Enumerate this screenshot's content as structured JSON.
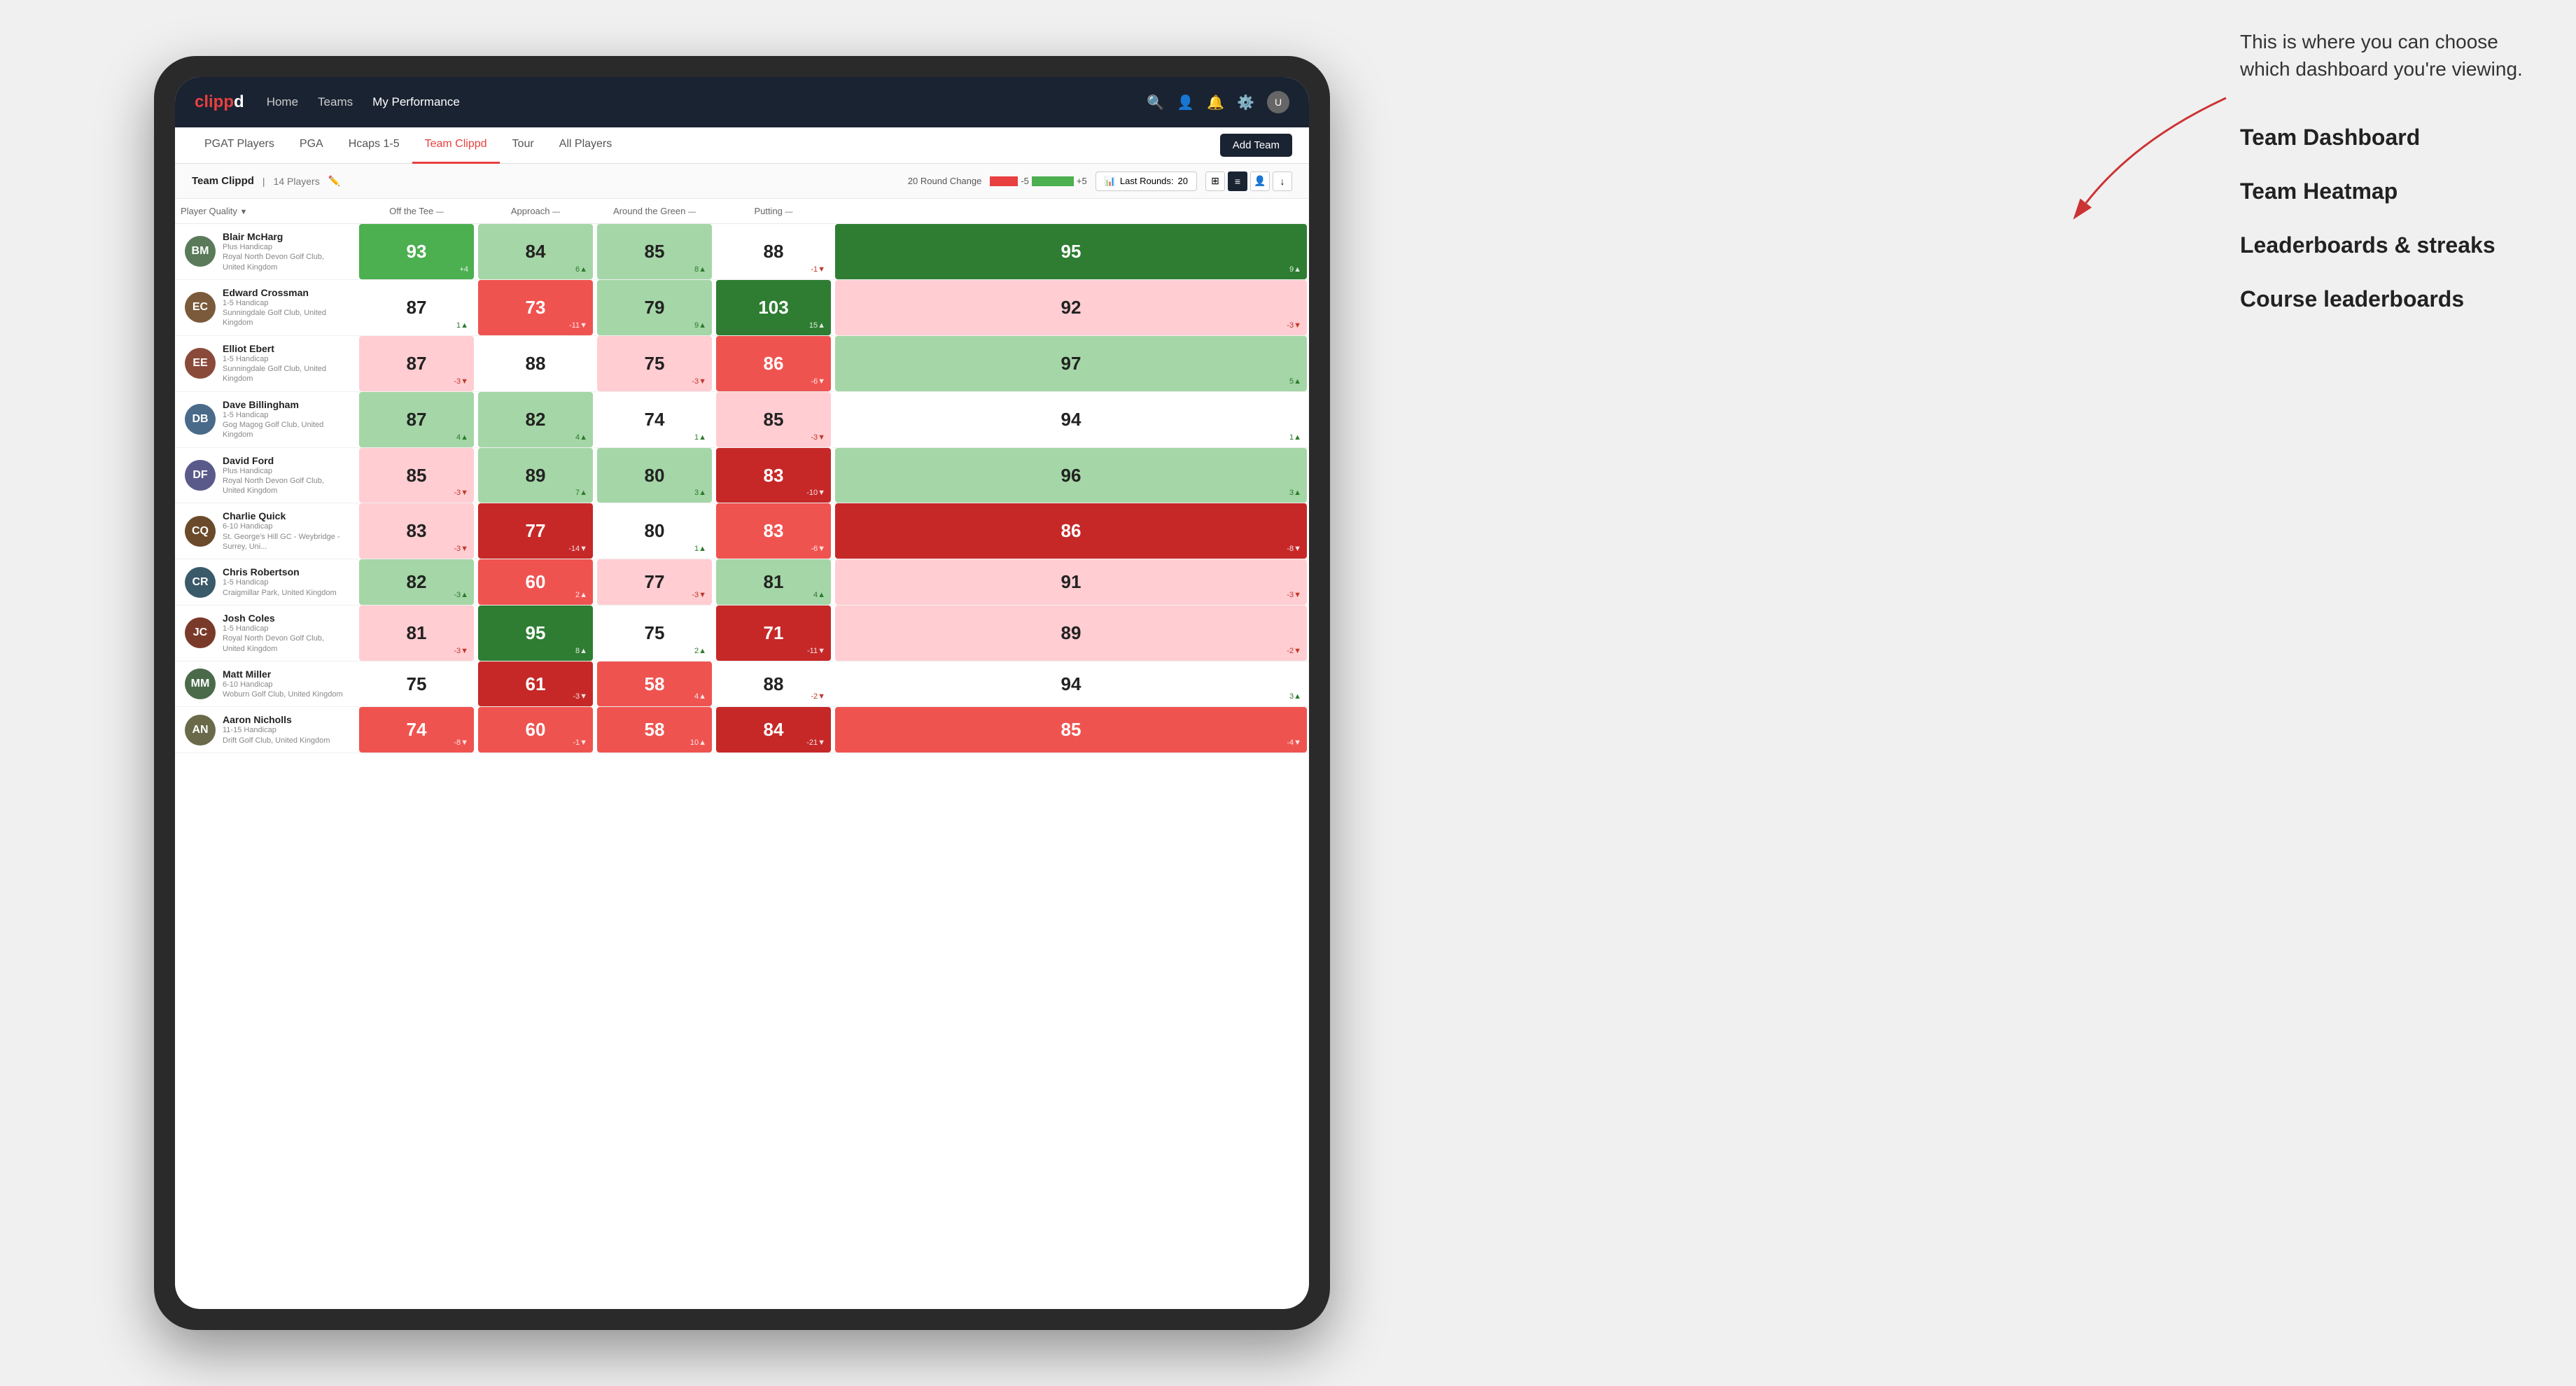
{
  "annotation": {
    "intro_text": "This is where you can choose which dashboard you're viewing.",
    "items": [
      "Team Dashboard",
      "Team Heatmap",
      "Leaderboards & streaks",
      "Course leaderboards"
    ]
  },
  "nav": {
    "logo": "clippd",
    "links": [
      "Home",
      "Teams",
      "My Performance"
    ],
    "active_link": "My Performance"
  },
  "sub_nav": {
    "tabs": [
      "PGAT Players",
      "PGA",
      "Hcaps 1-5",
      "Team Clippd",
      "Tour",
      "All Players"
    ],
    "active_tab": "Team Clippd",
    "add_team_label": "Add Team"
  },
  "team_bar": {
    "team_name": "Team Clippd",
    "player_count": "14 Players",
    "round_change_label": "20 Round Change",
    "round_change_neg": "-5",
    "round_change_pos": "+5",
    "last_rounds_label": "Last Rounds:",
    "last_rounds_val": "20"
  },
  "table_headers": {
    "player_quality": "Player Quality",
    "off_tee": "Off the Tee",
    "approach": "Approach",
    "around_green": "Around the Green",
    "putting": "Putting"
  },
  "players": [
    {
      "name": "Blair McHarg",
      "handicap": "Plus Handicap",
      "club": "Royal North Devon Golf Club, United Kingdom",
      "initials": "BM",
      "color": "#5a7a5a",
      "player_quality": {
        "score": 93,
        "change": "+4",
        "dir": "up",
        "bg": "bg-green-mid"
      },
      "off_tee": {
        "score": 84,
        "change": "6▲",
        "dir": "up",
        "bg": "bg-green-light"
      },
      "approach": {
        "score": 85,
        "change": "8▲",
        "dir": "up",
        "bg": "bg-green-light"
      },
      "around_green": {
        "score": 88,
        "change": "-1▼",
        "dir": "down",
        "bg": "bg-white"
      },
      "putting": {
        "score": 95,
        "change": "9▲",
        "dir": "up",
        "bg": "bg-green-strong"
      }
    },
    {
      "name": "Edward Crossman",
      "handicap": "1-5 Handicap",
      "club": "Sunningdale Golf Club, United Kingdom",
      "initials": "EC",
      "color": "#7a5a3a",
      "player_quality": {
        "score": 87,
        "change": "1▲",
        "dir": "up",
        "bg": "bg-white"
      },
      "off_tee": {
        "score": 73,
        "change": "-11▼",
        "dir": "down",
        "bg": "bg-red-mid"
      },
      "approach": {
        "score": 79,
        "change": "9▲",
        "dir": "up",
        "bg": "bg-green-light"
      },
      "around_green": {
        "score": 103,
        "change": "15▲",
        "dir": "up",
        "bg": "bg-green-strong"
      },
      "putting": {
        "score": 92,
        "change": "-3▼",
        "dir": "down",
        "bg": "bg-red-light"
      }
    },
    {
      "name": "Elliot Ebert",
      "handicap": "1-5 Handicap",
      "club": "Sunningdale Golf Club, United Kingdom",
      "initials": "EE",
      "color": "#8a4a3a",
      "player_quality": {
        "score": 87,
        "change": "-3▼",
        "dir": "down",
        "bg": "bg-red-light"
      },
      "off_tee": {
        "score": 88,
        "change": "",
        "dir": "",
        "bg": "bg-white"
      },
      "approach": {
        "score": 75,
        "change": "-3▼",
        "dir": "down",
        "bg": "bg-red-light"
      },
      "around_green": {
        "score": 86,
        "change": "-6▼",
        "dir": "down",
        "bg": "bg-red-mid"
      },
      "putting": {
        "score": 97,
        "change": "5▲",
        "dir": "up",
        "bg": "bg-green-light"
      }
    },
    {
      "name": "Dave Billingham",
      "handicap": "1-5 Handicap",
      "club": "Gog Magog Golf Club, United Kingdom",
      "initials": "DB",
      "color": "#4a6a8a",
      "player_quality": {
        "score": 87,
        "change": "4▲",
        "dir": "up",
        "bg": "bg-green-light"
      },
      "off_tee": {
        "score": 82,
        "change": "4▲",
        "dir": "up",
        "bg": "bg-green-light"
      },
      "approach": {
        "score": 74,
        "change": "1▲",
        "dir": "up",
        "bg": "bg-white"
      },
      "around_green": {
        "score": 85,
        "change": "-3▼",
        "dir": "down",
        "bg": "bg-red-light"
      },
      "putting": {
        "score": 94,
        "change": "1▲",
        "dir": "up",
        "bg": "bg-white"
      }
    },
    {
      "name": "David Ford",
      "handicap": "Plus Handicap",
      "club": "Royal North Devon Golf Club, United Kingdom",
      "initials": "DF",
      "color": "#5a5a8a",
      "player_quality": {
        "score": 85,
        "change": "-3▼",
        "dir": "down",
        "bg": "bg-red-light"
      },
      "off_tee": {
        "score": 89,
        "change": "7▲",
        "dir": "up",
        "bg": "bg-green-light"
      },
      "approach": {
        "score": 80,
        "change": "3▲",
        "dir": "up",
        "bg": "bg-green-light"
      },
      "around_green": {
        "score": 83,
        "change": "-10▼",
        "dir": "down",
        "bg": "bg-red-strong"
      },
      "putting": {
        "score": 96,
        "change": "3▲",
        "dir": "up",
        "bg": "bg-green-light"
      }
    },
    {
      "name": "Charlie Quick",
      "handicap": "6-10 Handicap",
      "club": "St. George's Hill GC - Weybridge - Surrey, Uni...",
      "initials": "CQ",
      "color": "#6a4a2a",
      "player_quality": {
        "score": 83,
        "change": "-3▼",
        "dir": "down",
        "bg": "bg-red-light"
      },
      "off_tee": {
        "score": 77,
        "change": "-14▼",
        "dir": "down",
        "bg": "bg-red-strong"
      },
      "approach": {
        "score": 80,
        "change": "1▲",
        "dir": "up",
        "bg": "bg-white"
      },
      "around_green": {
        "score": 83,
        "change": "-6▼",
        "dir": "down",
        "bg": "bg-red-mid"
      },
      "putting": {
        "score": 86,
        "change": "-8▼",
        "dir": "down",
        "bg": "bg-red-strong"
      }
    },
    {
      "name": "Chris Robertson",
      "handicap": "1-5 Handicap",
      "club": "Craigmillar Park, United Kingdom",
      "initials": "CR",
      "color": "#3a5a6a",
      "player_quality": {
        "score": 82,
        "change": "-3▲",
        "dir": "up",
        "bg": "bg-green-light"
      },
      "off_tee": {
        "score": 60,
        "change": "2▲",
        "dir": "up",
        "bg": "bg-red-mid"
      },
      "approach": {
        "score": 77,
        "change": "-3▼",
        "dir": "down",
        "bg": "bg-red-light"
      },
      "around_green": {
        "score": 81,
        "change": "4▲",
        "dir": "up",
        "bg": "bg-green-light"
      },
      "putting": {
        "score": 91,
        "change": "-3▼",
        "dir": "down",
        "bg": "bg-red-light"
      }
    },
    {
      "name": "Josh Coles",
      "handicap": "1-5 Handicap",
      "club": "Royal North Devon Golf Club, United Kingdom",
      "initials": "JC",
      "color": "#7a3a2a",
      "player_quality": {
        "score": 81,
        "change": "-3▼",
        "dir": "down",
        "bg": "bg-red-light"
      },
      "off_tee": {
        "score": 95,
        "change": "8▲",
        "dir": "up",
        "bg": "bg-green-strong"
      },
      "approach": {
        "score": 75,
        "change": "2▲",
        "dir": "up",
        "bg": "bg-white"
      },
      "around_green": {
        "score": 71,
        "change": "-11▼",
        "dir": "down",
        "bg": "bg-red-strong"
      },
      "putting": {
        "score": 89,
        "change": "-2▼",
        "dir": "down",
        "bg": "bg-red-light"
      }
    },
    {
      "name": "Matt Miller",
      "handicap": "6-10 Handicap",
      "club": "Woburn Golf Club, United Kingdom",
      "initials": "MM",
      "color": "#4a6a4a",
      "player_quality": {
        "score": 75,
        "change": "",
        "dir": "",
        "bg": "bg-white"
      },
      "off_tee": {
        "score": 61,
        "change": "-3▼",
        "dir": "down",
        "bg": "bg-red-strong"
      },
      "approach": {
        "score": 58,
        "change": "4▲",
        "dir": "up",
        "bg": "bg-red-mid"
      },
      "around_green": {
        "score": 88,
        "change": "-2▼",
        "dir": "down",
        "bg": "bg-white"
      },
      "putting": {
        "score": 94,
        "change": "3▲",
        "dir": "up",
        "bg": "bg-white"
      }
    },
    {
      "name": "Aaron Nicholls",
      "handicap": "11-15 Handicap",
      "club": "Drift Golf Club, United Kingdom",
      "initials": "AN",
      "color": "#6a6a4a",
      "player_quality": {
        "score": 74,
        "change": "-8▼",
        "dir": "down",
        "bg": "bg-red-mid"
      },
      "off_tee": {
        "score": 60,
        "change": "-1▼",
        "dir": "down",
        "bg": "bg-red-mid"
      },
      "approach": {
        "score": 58,
        "change": "10▲",
        "dir": "up",
        "bg": "bg-red-mid"
      },
      "around_green": {
        "score": 84,
        "change": "-21▼",
        "dir": "down",
        "bg": "bg-red-strong"
      },
      "putting": {
        "score": 85,
        "change": "-4▼",
        "dir": "down",
        "bg": "bg-red-mid"
      }
    }
  ]
}
